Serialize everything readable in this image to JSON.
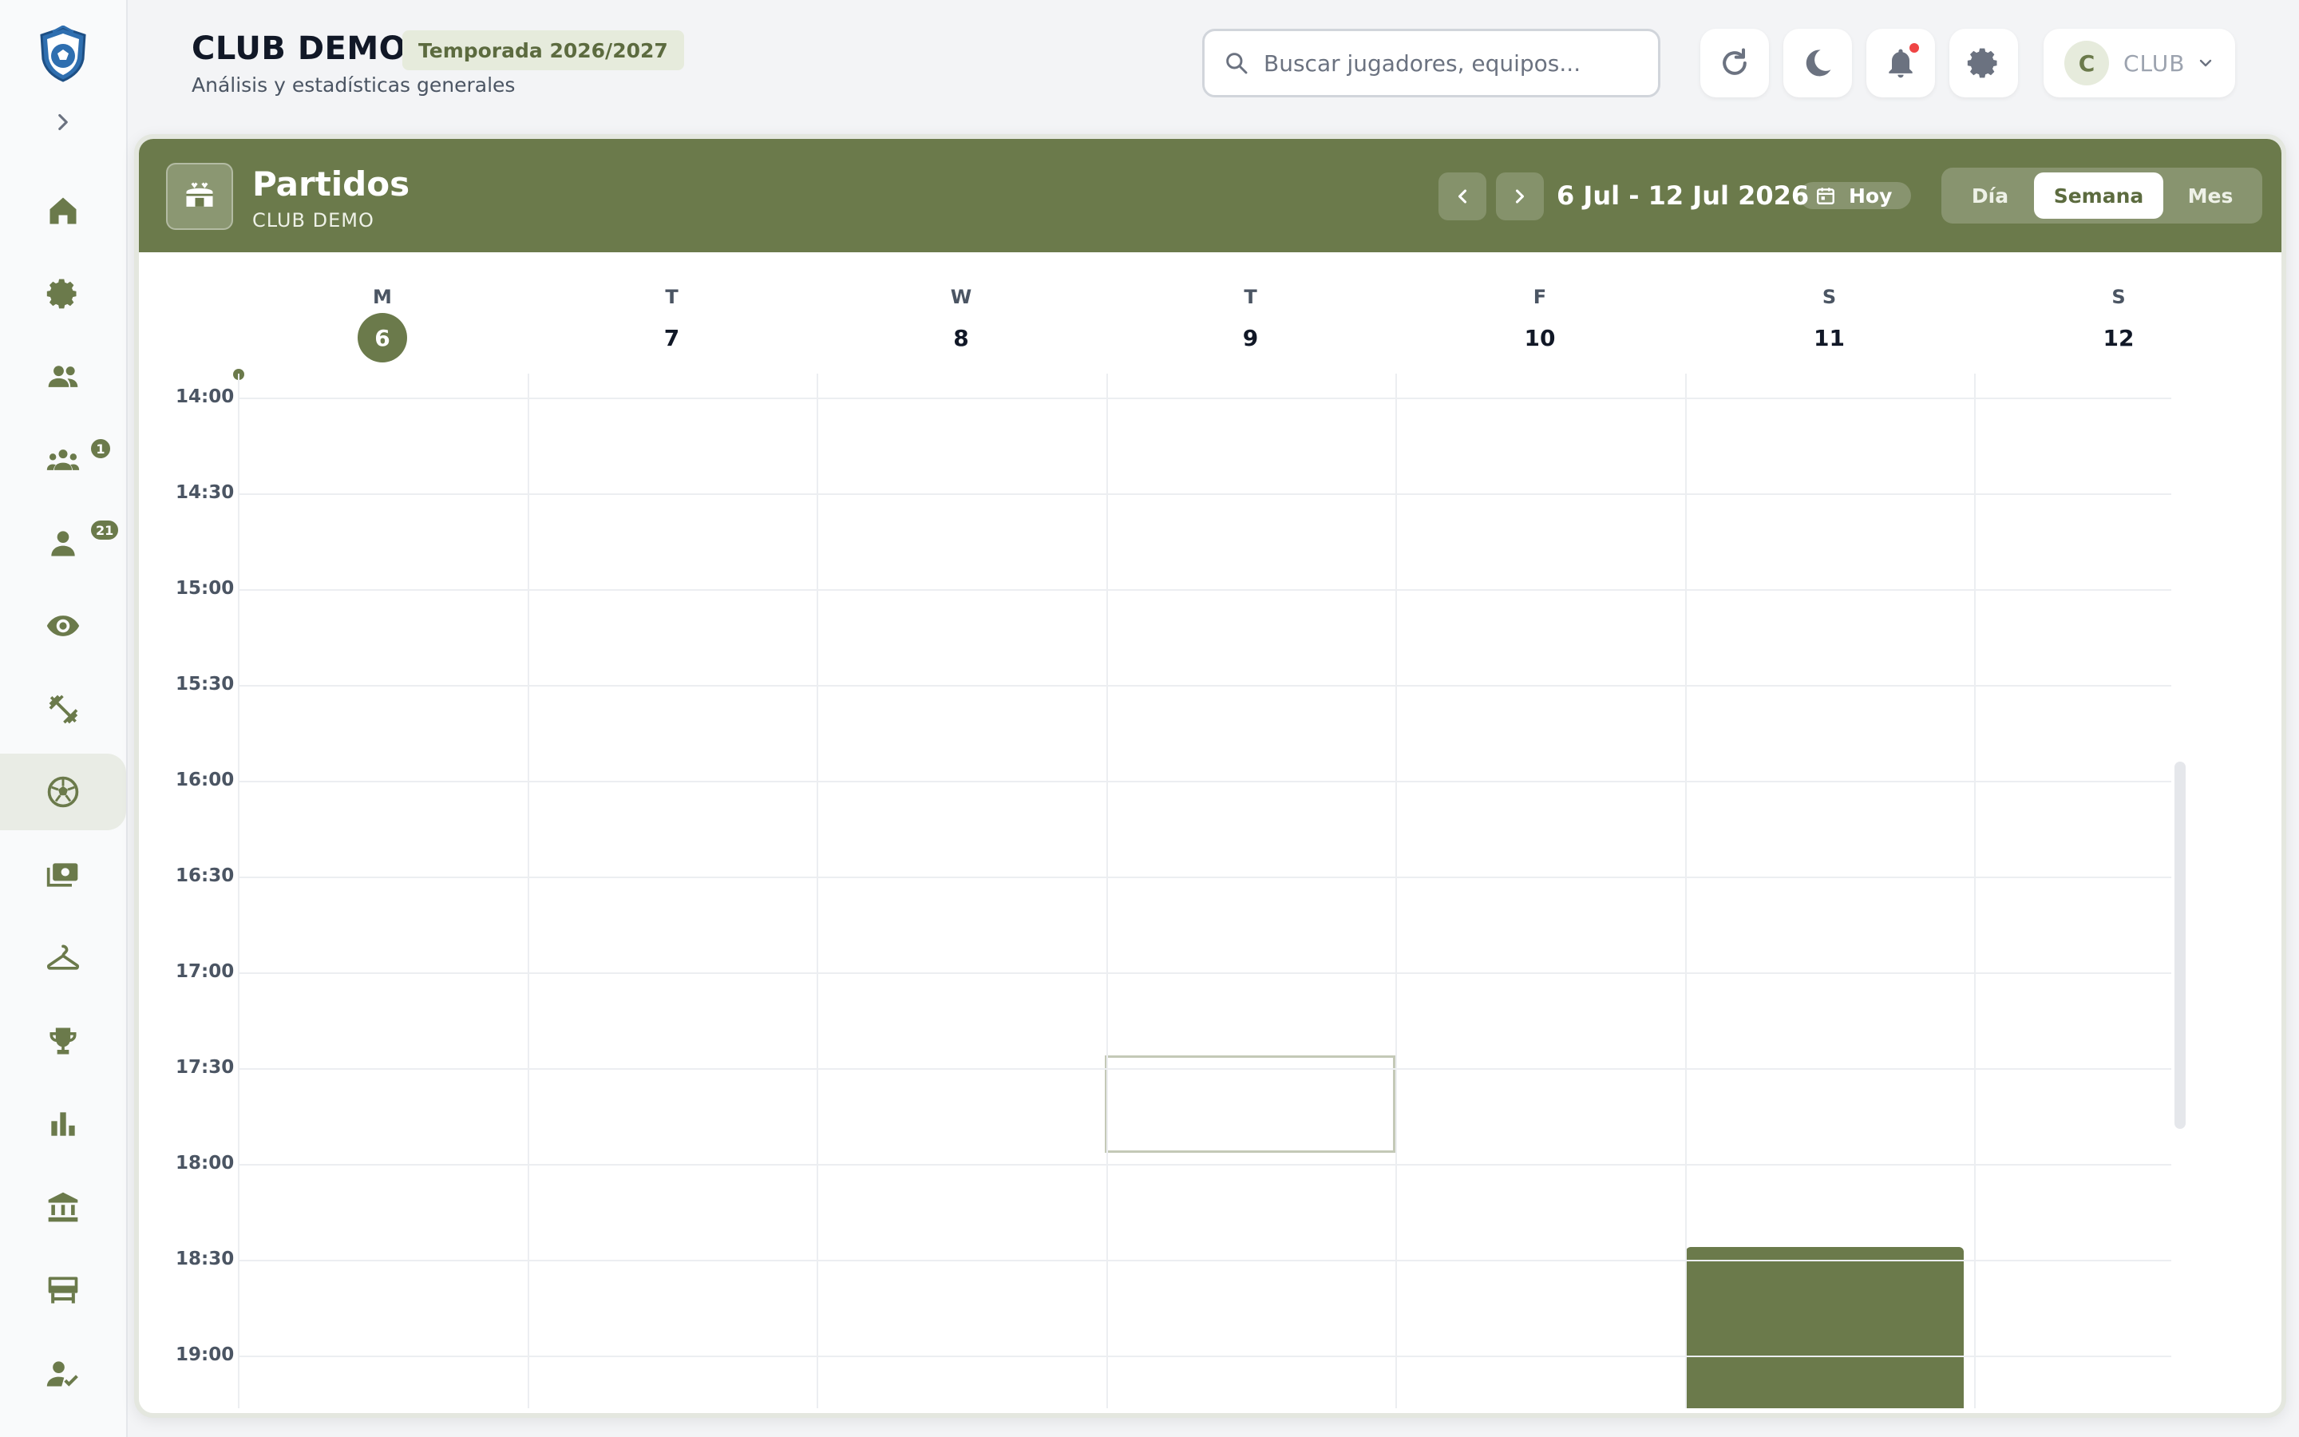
{
  "header": {
    "club_title": "CLUB DEMO",
    "season": "Temporada 2026/2027",
    "subtitle": "Análisis y estadísticas generales",
    "search_placeholder": "Buscar jugadores, equipos...",
    "user_initial": "C",
    "user_name": "CLUB"
  },
  "sidebar": {
    "items": [
      {
        "icon": "home-icon"
      },
      {
        "icon": "gear-icon"
      },
      {
        "icon": "team-icon"
      },
      {
        "icon": "groups-icon",
        "badge": "1"
      },
      {
        "icon": "person-icon",
        "badge": "21"
      },
      {
        "icon": "eye-icon"
      },
      {
        "icon": "dumbbell-icon"
      },
      {
        "icon": "soccer-ball-icon",
        "active": true
      },
      {
        "icon": "payments-icon"
      },
      {
        "icon": "hanger-icon"
      },
      {
        "icon": "trophy-icon"
      },
      {
        "icon": "bar-chart-icon"
      },
      {
        "icon": "bank-icon"
      },
      {
        "icon": "display-icon"
      },
      {
        "icon": "person-check-icon"
      }
    ]
  },
  "panel": {
    "title": "Partidos",
    "subtitle": "CLUB DEMO",
    "range_label": "6 Jul - 12 Jul 2026",
    "today_label": "Hoy",
    "views": {
      "day": "Día",
      "week": "Semana",
      "month": "Mes"
    },
    "active_view": "Semana"
  },
  "calendar": {
    "days": [
      {
        "dow": "M",
        "num": "6",
        "today": true
      },
      {
        "dow": "T",
        "num": "7"
      },
      {
        "dow": "W",
        "num": "8"
      },
      {
        "dow": "T",
        "num": "9"
      },
      {
        "dow": "F",
        "num": "10"
      },
      {
        "dow": "S",
        "num": "11"
      },
      {
        "dow": "S",
        "num": "12"
      }
    ],
    "times": [
      "14:00",
      "14:30",
      "15:00",
      "15:30",
      "16:00",
      "16:30",
      "17:00",
      "17:30",
      "18:00",
      "18:30",
      "19:00"
    ]
  },
  "colors": {
    "accent": "#6b7a4b",
    "accent_light": "#e6ebdc",
    "notification": "#ef4444"
  }
}
